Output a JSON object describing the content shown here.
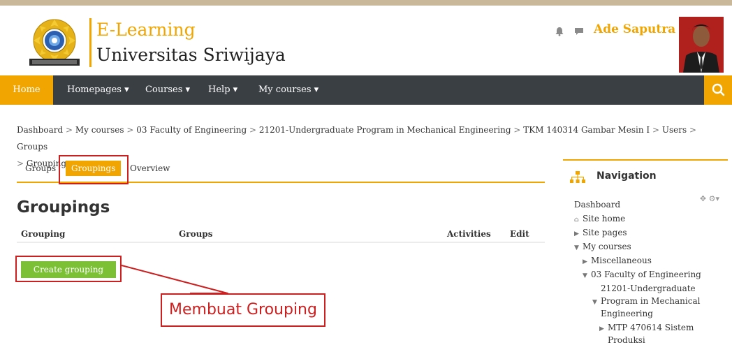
{
  "header": {
    "brand_line1": "E-Learning",
    "brand_line2": "Universitas  Sriwijaya",
    "user_name": "Ade Saputra",
    "user_caret": "▾",
    "colors": {
      "accent": "#f0a500",
      "navbar": "#3a3f44",
      "create_button": "#7cc135",
      "annotation": "#cc1f1f"
    }
  },
  "navbar": {
    "home": "Home",
    "items": [
      {
        "label": "Homepages ▾"
      },
      {
        "label": "Courses ▾"
      },
      {
        "label": "Help ▾"
      },
      {
        "label": "My courses ▾"
      }
    ],
    "search_icon": "search-icon"
  },
  "breadcrumb": {
    "items": [
      "Dashboard",
      "My courses",
      "03 Faculty of Engineering",
      "21201-Undergraduate Program in Mechanical Engineering",
      "TKM 140314 Gambar Mesin I",
      "Users",
      "Groups",
      "Groupings"
    ],
    "separator": ">"
  },
  "tabs": {
    "groups": "Groups",
    "groupings": "Groupings",
    "overview": "Overview"
  },
  "main": {
    "heading": "Groupings",
    "table_headers": {
      "grouping": "Grouping",
      "groups": "Groups",
      "activities": "Activities",
      "edit": "Edit"
    },
    "create_button": "Create grouping"
  },
  "annotation": {
    "callout": "Membuat Grouping"
  },
  "navigation_block": {
    "title": "Navigation",
    "tools": "✥ ⚙▾",
    "items": [
      {
        "label": "Dashboard"
      },
      {
        "label": "Site home"
      },
      {
        "label": "Site pages"
      },
      {
        "label": "My courses"
      },
      {
        "label": "Miscellaneous"
      },
      {
        "label": "03 Faculty of Engineering"
      },
      {
        "label": "21201-Undergraduate"
      },
      {
        "label": "Program in Mechanical"
      },
      {
        "label": "Engineering"
      },
      {
        "label": "MTP 470614 Sistem"
      },
      {
        "label": "Produksi"
      }
    ]
  }
}
